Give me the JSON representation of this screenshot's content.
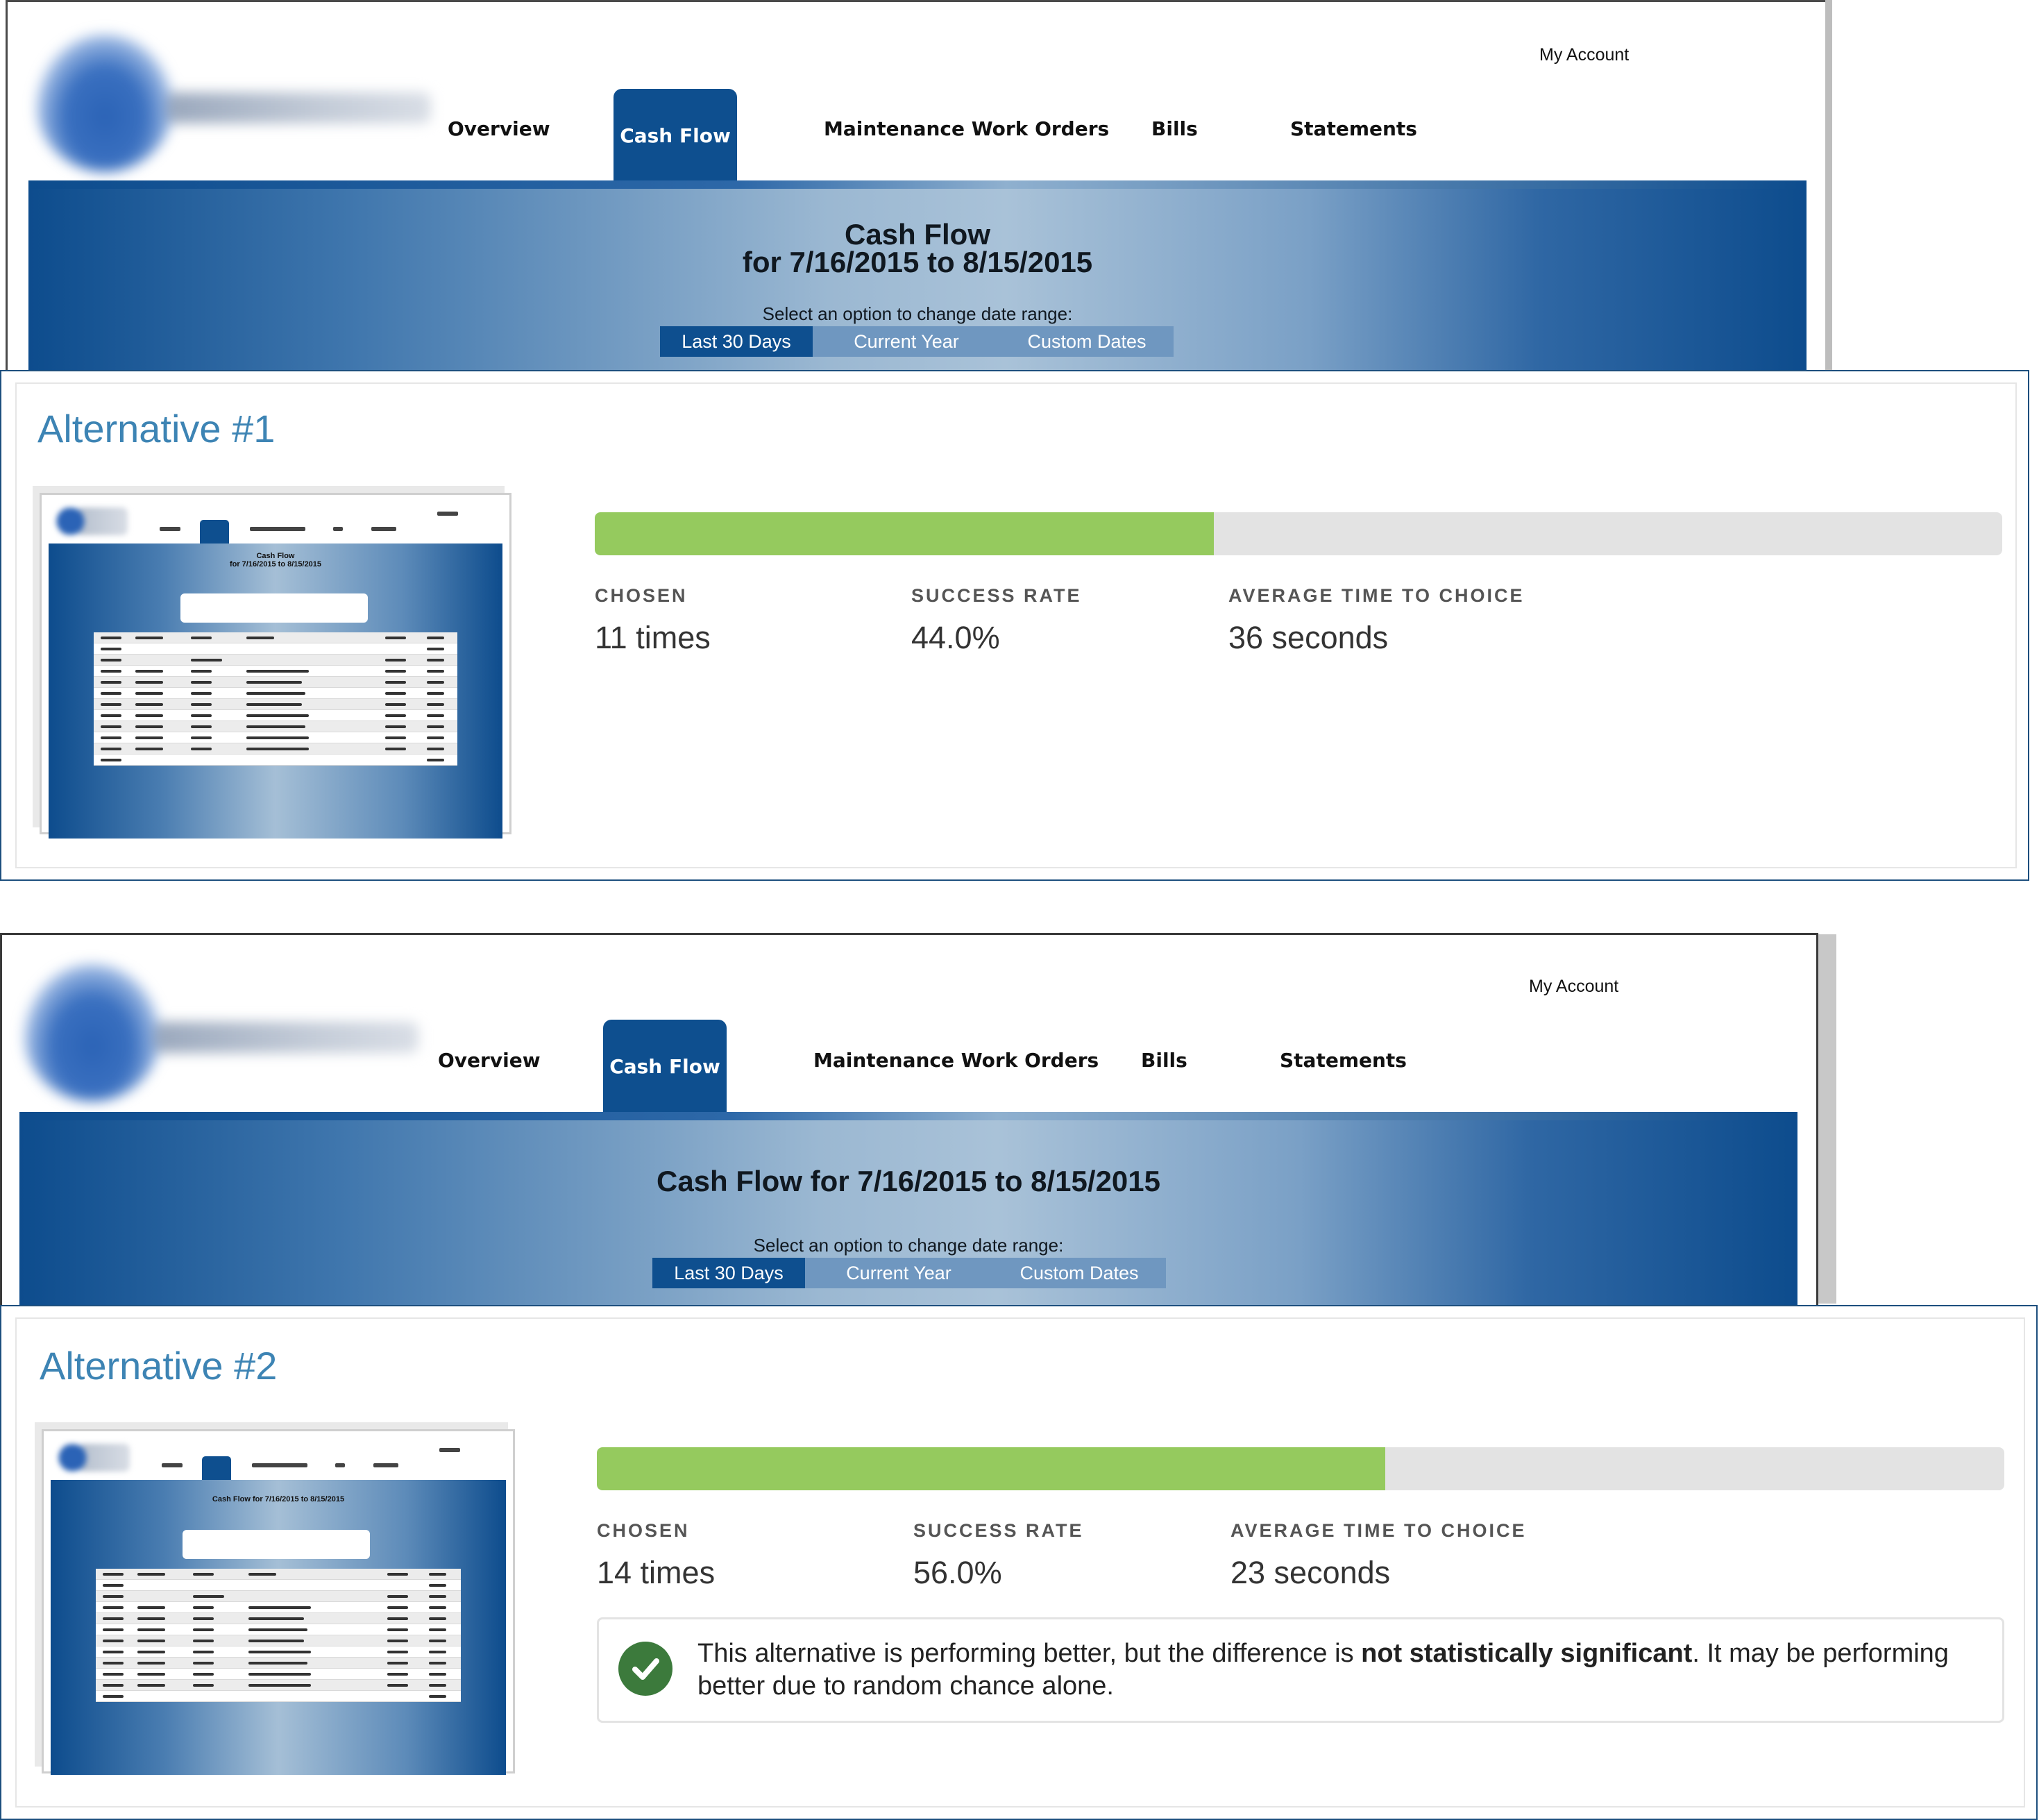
{
  "alternatives": [
    {
      "site": {
        "my_account": "My Account",
        "nav": [
          "Overview",
          "Cash Flow",
          "Maintenance Work Orders",
          "Bills",
          "Statements"
        ],
        "banner_title_line1": "Cash Flow",
        "banner_title_line2": "for 7/16/2015 to 8/15/2015",
        "prompt": "Select an option to change date range:",
        "range_options": [
          "Last 30 Days",
          "Current Year",
          "Custom Dates"
        ],
        "active_range": "Last 30 Days"
      },
      "title": "Alternative #1",
      "thumbnail": {
        "title_line1": "Cash Flow",
        "title_line2": "for 7/16/2015 to 8/15/2015"
      },
      "progress": 0.44,
      "stats": {
        "chosen_label": "CHOSEN",
        "chosen_value": "11 times",
        "success_label": "SUCCESS RATE",
        "success_value": "44.0%",
        "time_label": "AVERAGE TIME TO CHOICE",
        "time_value": "36 seconds"
      }
    },
    {
      "site": {
        "my_account": "My Account",
        "nav": [
          "Overview",
          "Cash Flow",
          "Maintenance Work Orders",
          "Bills",
          "Statements"
        ],
        "banner_title": "Cash Flow for 7/16/2015 to 8/15/2015",
        "prompt": "Select an option to change date range:",
        "range_options": [
          "Last 30 Days",
          "Current Year",
          "Custom Dates"
        ],
        "active_range": "Last 30 Days"
      },
      "title": "Alternative #2",
      "thumbnail": {
        "title": "Cash Flow for 7/16/2015 to 8/15/2015"
      },
      "progress": 0.56,
      "stats": {
        "chosen_label": "CHOSEN",
        "chosen_value": "14 times",
        "success_label": "SUCCESS RATE",
        "success_value": "56.0%",
        "time_label": "AVERAGE TIME TO CHOICE",
        "time_value": "23 seconds"
      },
      "notice": {
        "text_before": "This alternative is performing better, but the difference is ",
        "text_bold": "not statistically significant",
        "text_after": ". It may be performing better due to random chance alone."
      }
    }
  ],
  "colors": {
    "brand_blue": "#0e4f8f",
    "range_inactive": "#6f97c0",
    "title_blue": "#3d84b4",
    "progress_green": "#95ca5e",
    "progress_track": "#e3e3e3",
    "check_green": "#3c7a3c"
  },
  "icons": [
    "checkmark-circle-icon"
  ]
}
